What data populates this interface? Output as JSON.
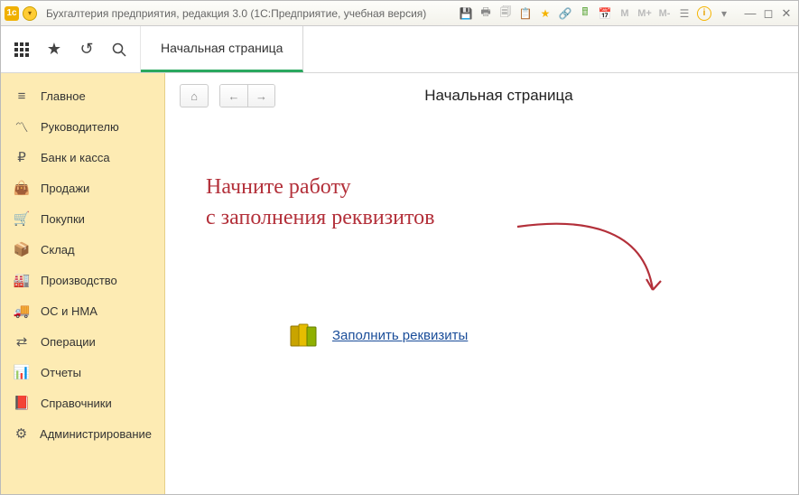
{
  "titlebar": {
    "title": "Бухгалтерия предприятия, редакция 3.0  (1С:Предприятие, учебная версия)",
    "m_buttons": [
      "M",
      "M+",
      "M-"
    ]
  },
  "toolbar": {
    "tab_label": "Начальная страница"
  },
  "sidebar": {
    "items": [
      {
        "label": "Главное"
      },
      {
        "label": "Руководителю"
      },
      {
        "label": "Банк и касса"
      },
      {
        "label": "Продажи"
      },
      {
        "label": "Покупки"
      },
      {
        "label": "Склад"
      },
      {
        "label": "Производство"
      },
      {
        "label": "ОС и НМА"
      },
      {
        "label": "Операции"
      },
      {
        "label": "Отчеты"
      },
      {
        "label": "Справочники"
      },
      {
        "label": "Администрирование"
      }
    ]
  },
  "page": {
    "title": "Начальная страница",
    "hint_line1": "Начните работу",
    "hint_line2": "с заполнения реквизитов",
    "action_link": "Заполнить реквизиты"
  }
}
